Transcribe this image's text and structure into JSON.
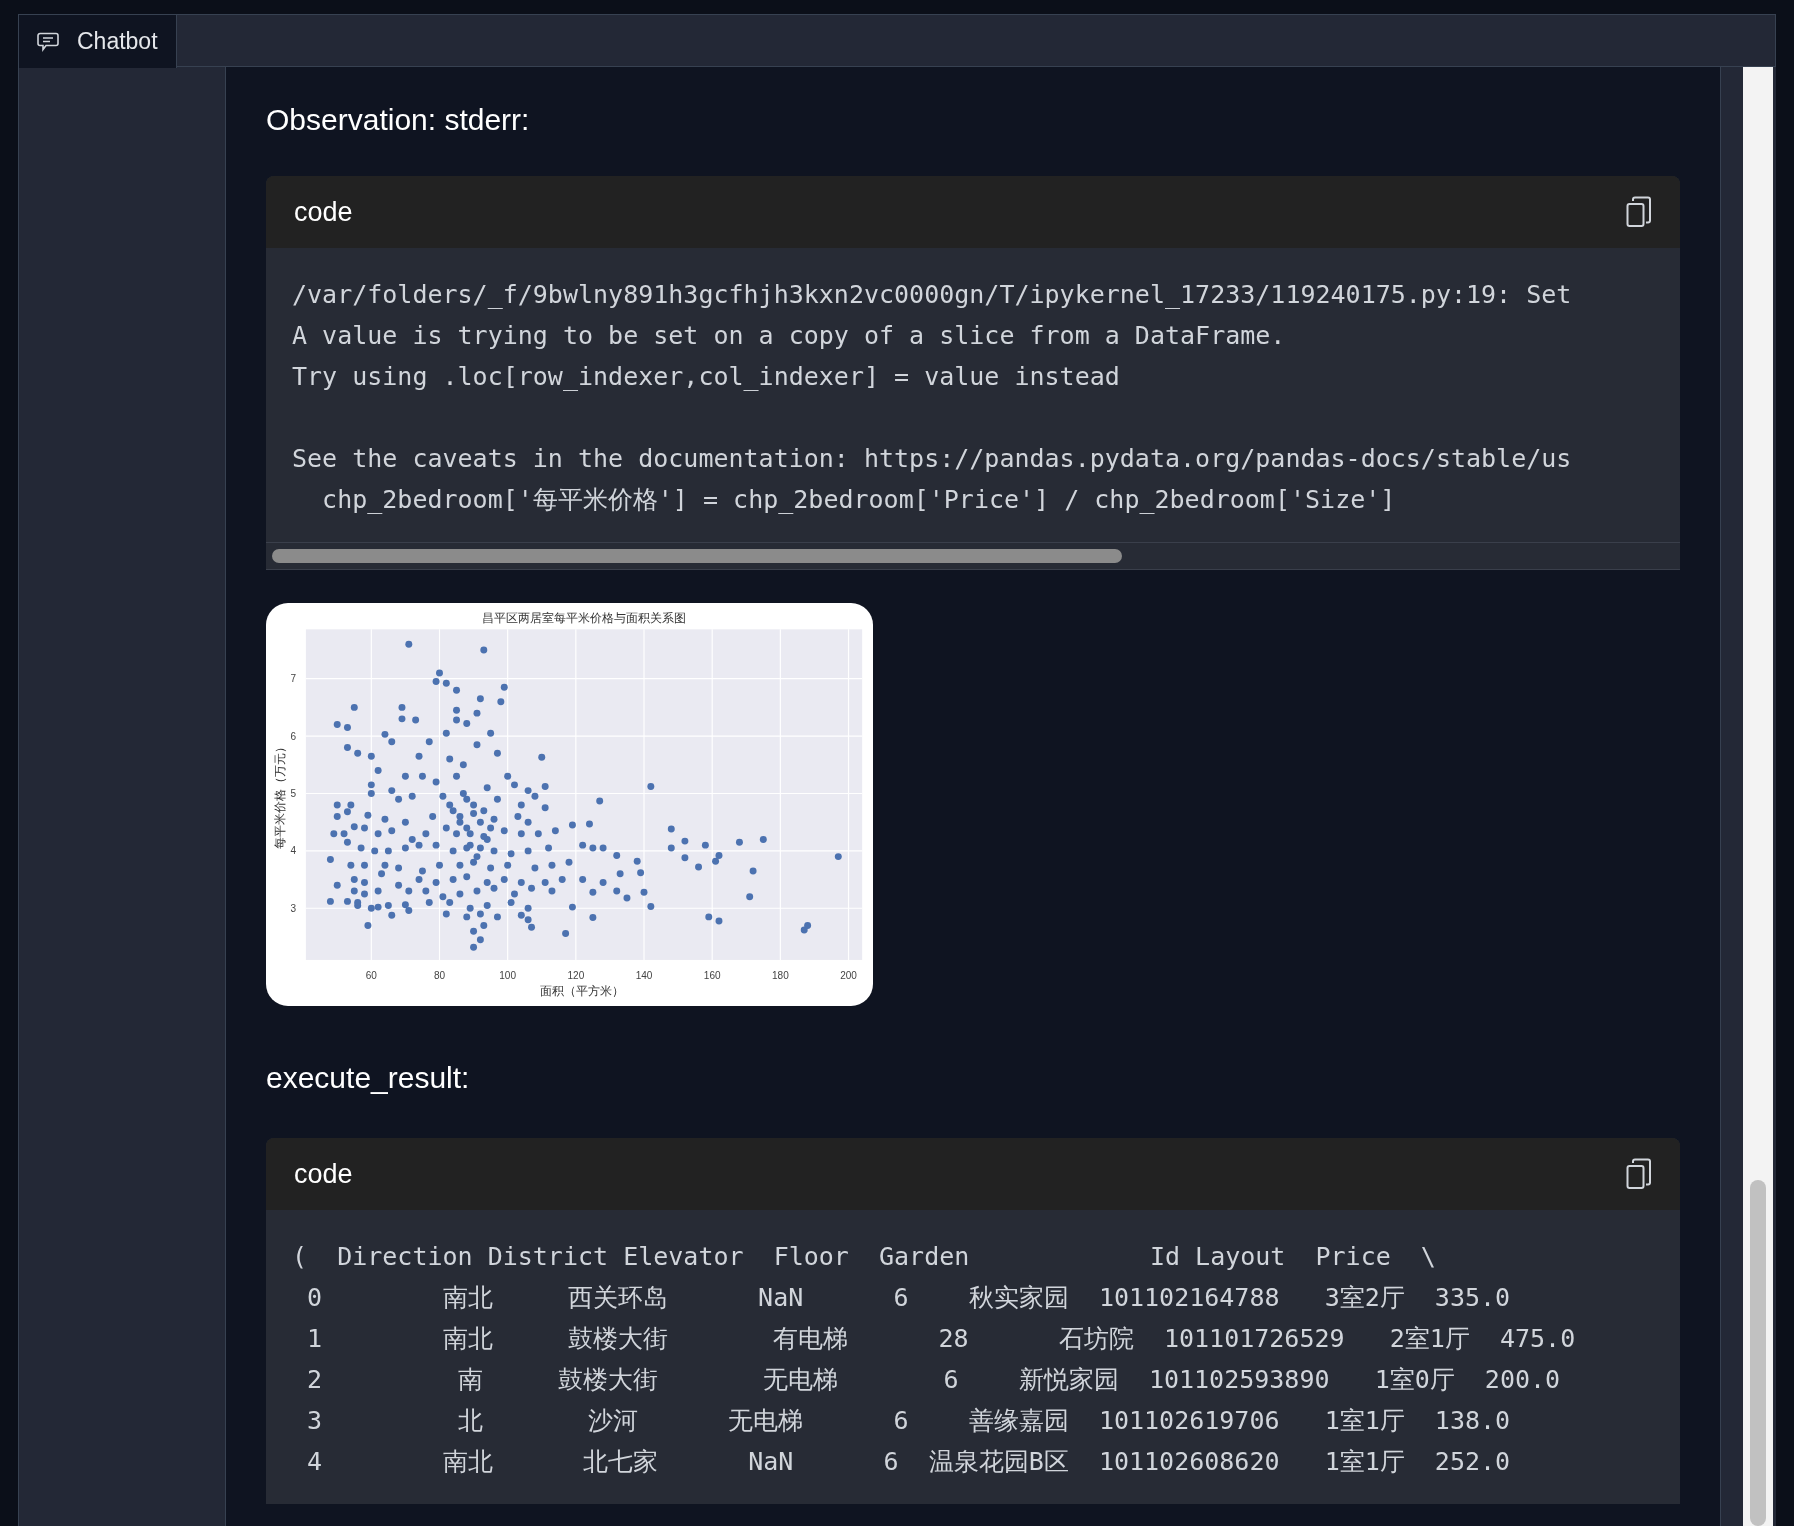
{
  "tab": {
    "label": "Chatbot",
    "selected": true
  },
  "messages": [
    {
      "kind": "heading",
      "text": "Observation: stderr:"
    },
    {
      "kind": "code",
      "label": "code",
      "paragraphs": [
        [
          "/var/folders/_f/9bwlny891h3gcfhjh3kxn2vc0000gn/T/ipykernel_17233/119240175.py:19: Set",
          "A value is trying to be set on a copy of a slice from a DataFrame.",
          "Try using .loc[row_indexer,col_indexer] = value instead"
        ],
        [
          "See the caveats in the documentation: https://pandas.pydata.org/pandas-docs/stable/us",
          "  chp_2bedroom['每平米价格'] = chp_2bedroom['Price'] / chp_2bedroom['Size']"
        ]
      ],
      "hscroll": true
    },
    {
      "kind": "chart",
      "chart_data": {
        "type": "scatter",
        "grid": true,
        "title": "昌平区两居室每平米价格与面积关系图",
        "xlabel": "面积（平方米）",
        "ylabel": "每平米价格（万元）",
        "xlim": [
          40.8,
          204
        ],
        "ylim": [
          2.1,
          7.86
        ],
        "xticks": [
          60,
          80,
          100,
          120,
          140,
          160,
          180,
          200
        ],
        "yticks": [
          3,
          4,
          5,
          6,
          7
        ],
        "x": [
          71,
          93,
          80,
          79,
          82,
          85,
          99,
          98,
          92,
          55,
          69,
          85,
          91,
          69,
          73,
          50,
          53,
          85,
          88,
          64,
          82,
          95,
          53,
          56,
          66,
          77,
          110,
          60,
          74,
          91,
          97,
          62,
          70,
          83,
          87,
          100,
          102,
          111,
          142,
          60,
          66,
          75,
          79,
          85,
          94,
          106,
          127,
          50,
          54,
          60,
          68,
          72,
          81,
          88,
          97,
          104,
          108,
          111,
          50,
          53,
          59,
          64,
          70,
          78,
          84,
          90,
          96,
          103,
          106,
          119,
          124,
          49,
          52,
          55,
          58,
          62,
          66,
          72,
          76,
          82,
          86,
          89,
          93,
          99,
          104,
          109,
          114,
          148,
          152,
          158,
          168,
          175,
          48,
          53,
          57,
          61,
          65,
          70,
          74,
          79,
          84,
          88,
          92,
          96,
          101,
          106,
          112,
          122,
          125,
          128,
          148,
          152,
          162,
          161,
          197,
          54,
          58,
          64,
          68,
          75,
          80,
          86,
          90,
          95,
          100,
          108,
          113,
          118,
          132,
          138,
          156,
          50,
          55,
          58,
          63,
          68,
          74,
          79,
          84,
          88,
          94,
          99,
          104,
          111,
          116,
          122,
          128,
          133,
          139,
          172,
          55,
          58,
          62,
          71,
          76,
          81,
          86,
          91,
          96,
          102,
          107,
          113,
          125,
          132,
          140,
          48,
          53,
          56,
          60,
          65,
          70,
          77,
          83,
          89,
          94,
          101,
          106,
          119,
          135,
          142,
          171,
          56,
          62,
          66,
          71,
          82,
          88,
          92,
          97,
          104,
          106,
          125,
          159,
          162,
          59,
          93,
          107,
          90,
          117,
          92,
          90,
          187,
          188,
          86,
          88,
          90,
          92,
          94,
          87,
          89,
          91,
          93,
          85,
          95,
          83
        ],
        "series": [
          {
            "color": "#4c72b0",
            "values": [
              7.6,
              7.5,
              7.1,
              6.95,
              6.92,
              6.8,
              6.85,
              6.6,
              6.65,
              6.5,
              6.5,
              6.45,
              6.4,
              6.3,
              6.28,
              6.2,
              6.15,
              6.28,
              6.22,
              6.03,
              6.05,
              6.05,
              5.8,
              5.7,
              5.9,
              5.9,
              5.63,
              5.65,
              5.65,
              5.85,
              5.7,
              5.4,
              5.3,
              5.6,
              5.5,
              5.3,
              5.15,
              5.12,
              5.12,
              5.15,
              5.05,
              5.3,
              5.2,
              5.3,
              5.1,
              5.05,
              4.87,
              4.8,
              4.8,
              5.0,
              4.9,
              4.95,
              4.95,
              4.9,
              4.9,
              4.8,
              4.95,
              4.75,
              4.6,
              4.68,
              4.62,
              4.55,
              4.5,
              4.6,
              4.7,
              4.65,
              4.55,
              4.6,
              4.5,
              4.45,
              4.47,
              4.3,
              4.3,
              4.42,
              4.4,
              4.3,
              4.35,
              4.2,
              4.3,
              4.4,
              4.5,
              4.3,
              4.25,
              4.35,
              4.3,
              4.3,
              4.35,
              4.38,
              4.17,
              4.1,
              4.15,
              4.2,
              3.85,
              4.15,
              4.05,
              4.0,
              4.0,
              4.05,
              4.1,
              4.1,
              4.0,
              4.05,
              4.05,
              4.0,
              3.95,
              4.0,
              4.05,
              4.1,
              4.05,
              4.05,
              4.05,
              3.88,
              3.92,
              3.82,
              3.9,
              3.75,
              3.75,
              3.75,
              3.7,
              3.65,
              3.75,
              3.75,
              3.8,
              3.7,
              3.75,
              3.7,
              3.75,
              3.8,
              3.92,
              3.82,
              3.72,
              3.4,
              3.5,
              3.45,
              3.6,
              3.4,
              3.5,
              3.45,
              3.5,
              3.55,
              3.45,
              3.5,
              3.45,
              3.45,
              3.5,
              3.5,
              3.45,
              3.6,
              3.62,
              3.65,
              3.3,
              3.25,
              3.3,
              3.3,
              3.3,
              3.2,
              3.25,
              3.3,
              3.35,
              3.25,
              3.35,
              3.3,
              3.28,
              3.3,
              3.28,
              3.12,
              3.12,
              3.05,
              3.0,
              3.05,
              3.06,
              3.1,
              3.1,
              3.0,
              3.05,
              3.1,
              3.0,
              3.02,
              3.18,
              3.03,
              3.2,
              3.1,
              3.02,
              2.88,
              2.96,
              2.9,
              2.85,
              2.9,
              2.85,
              2.88,
              2.8,
              2.84,
              2.85,
              2.78,
              2.7,
              2.7,
              2.67,
              2.6,
              2.56,
              2.45,
              2.32,
              2.62,
              2.7,
              4.6,
              4.4,
              4.8,
              4.5,
              4.2,
              5.0,
              4.1,
              3.9,
              4.7,
              4.3,
              4.4,
              4.8
            ]
          }
        ]
      }
    },
    {
      "kind": "heading",
      "text": "execute_result:"
    },
    {
      "kind": "code",
      "label": "code",
      "paragraphs": [
        [
          "(  Direction District Elevator  Floor  Garden            Id Layout  Price  \\",
          " 0        南北     西关环岛      NaN      6    秋实家园  101102164788   3室2厅  335.0",
          " 1        南北     鼓楼大街       有电梯      28      石坊院  101101726529   2室1厅  475.0",
          " 2         南     鼓楼大街       无电梯       6    新悦家园  101102593890   1室0厅  200.0",
          " 3         北       沙河      无电梯      6    善缘嘉园  101102619706   1室1厅  138.0",
          " 4        南北      北七家      NaN      6  温泉花园B区  101102608620   1室1厅  252.0"
        ]
      ],
      "hscroll": false
    }
  ]
}
